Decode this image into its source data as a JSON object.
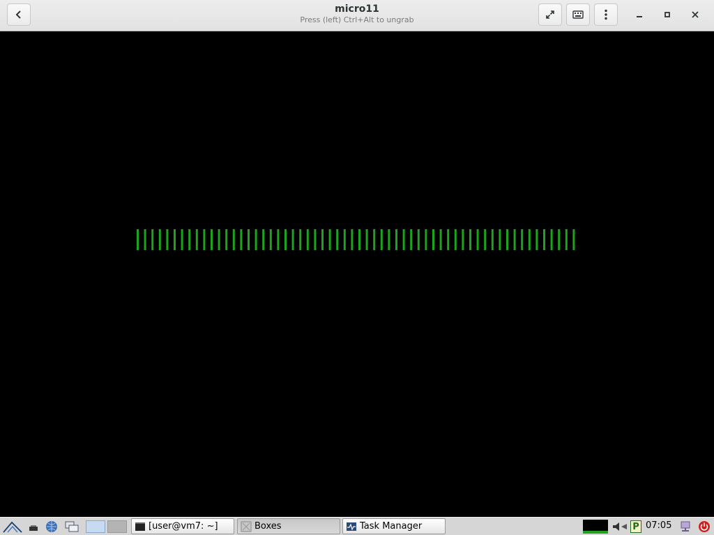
{
  "window": {
    "title": "micro11",
    "subtitle": "Press (left) Ctrl+Alt to ungrab"
  },
  "header_buttons": {
    "back": "back-icon",
    "fullscreen": "fullscreen-icon",
    "keyboard": "keyboard-icon",
    "menu": "menu-dots-icon",
    "minimize": "minimize-icon",
    "maximize": "maximize-icon",
    "close": "close-icon"
  },
  "guest_screen": {
    "progress_bar_count": 60,
    "bar_color": "#1fa31f"
  },
  "taskbar": {
    "tasks": [
      {
        "label": "[user@vm7: ~]",
        "icon": "terminal-icon"
      },
      {
        "label": "Boxes",
        "icon": "boxes-icon",
        "active": true
      },
      {
        "label": "Task Manager",
        "icon": "task-manager-icon"
      }
    ],
    "clock": "07:05",
    "tray_indicator": "P"
  },
  "colors": {
    "header_bg": "#e8e8e8",
    "guest_bg": "#000000",
    "taskbar_bg": "#d6d6d6",
    "power_red": "#d21e1e"
  }
}
